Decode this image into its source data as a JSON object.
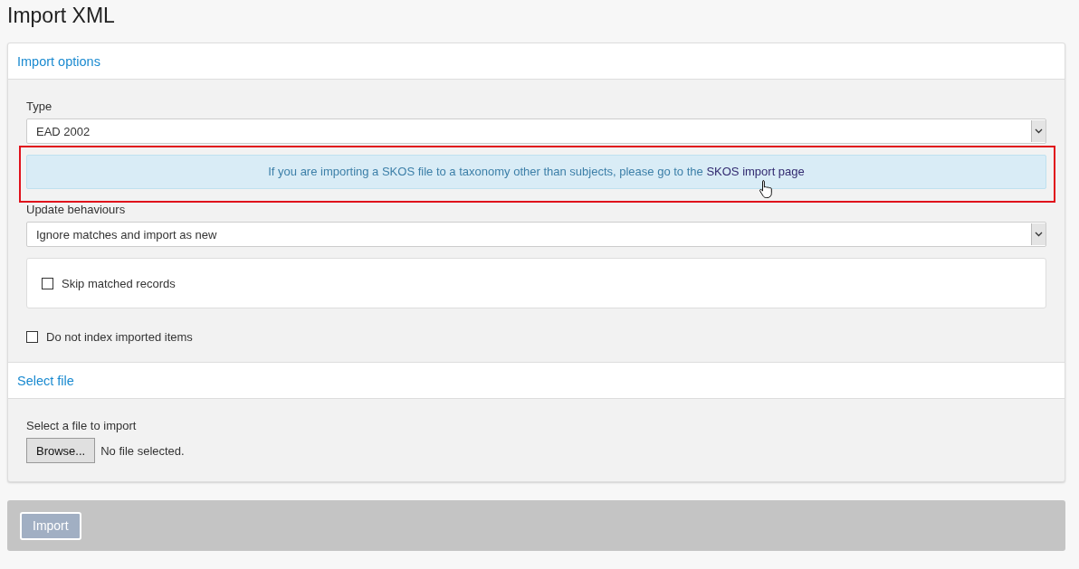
{
  "page": {
    "title": "Import XML"
  },
  "sections": [
    {
      "kind": "options",
      "title": "Import options",
      "type_label": "Type",
      "type_value": "EAD 2002",
      "alert": {
        "text": "If you are importing a SKOS file to a taxonomy other than subjects, please go to the",
        "link": "SKOS import page",
        "highlighted": true,
        "cursor": true
      },
      "update_label": "Update behaviours",
      "update_value": "Ignore matches and import as new",
      "skip": {
        "label": "Skip matched records",
        "checked": false
      },
      "no_index": {
        "label": "Do not index imported items",
        "checked": false
      }
    },
    {
      "kind": "file",
      "title": "Select file",
      "file_label": "Select a file to import",
      "browse": "Browse...",
      "file_status": "No file selected."
    }
  ],
  "footer": {
    "button": "Import",
    "disabled": true
  }
}
